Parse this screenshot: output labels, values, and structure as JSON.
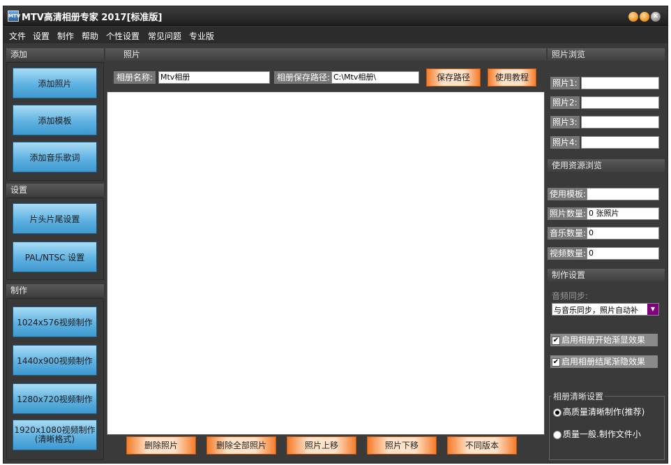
{
  "window": {
    "title": "MTV高清相册专家 2017[标准版]",
    "icon_text": "MTV"
  },
  "menu": [
    "文件",
    "设置",
    "制作",
    "帮助",
    "个性设置",
    "常见问题",
    "专业版"
  ],
  "left": {
    "add_header": "添加",
    "add_buttons": [
      "添加照片",
      "添加模板",
      "添加音乐歌词"
    ],
    "settings_header": "设置",
    "settings_buttons": [
      "片头片尾设置",
      "PAL/NTSC 设置"
    ],
    "make_header": "制作",
    "make_buttons": [
      "1024x576视频制作",
      "1440x900视频制作",
      "1280x720视频制作"
    ],
    "make_last": {
      "line1": "1920x1080视频制作",
      "line2": "(清晰格式)"
    }
  },
  "center": {
    "header": "照片",
    "album_name_label": "相册名称:",
    "album_name_value": "Mtv相册",
    "save_path_label": "相册保存路径:",
    "save_path_value": "C:\\Mtv相册\\",
    "save_path_button": "保存路径",
    "tutorial_button": "使用教程",
    "bottom_buttons": [
      "删除照片",
      "删除全部照片",
      "照片上移",
      "照片下移",
      "不同版本"
    ]
  },
  "right": {
    "photo_browse_header": "照片浏览",
    "photo_fields": [
      {
        "label": "照片1:",
        "value": ""
      },
      {
        "label": "照片2:",
        "value": ""
      },
      {
        "label": "照片3:",
        "value": ""
      },
      {
        "label": "照片4:",
        "value": ""
      }
    ],
    "resource_header": "使用资源浏览",
    "resource_fields": [
      {
        "label": "使用模板:",
        "value": ""
      },
      {
        "label": "照片数量:",
        "value": "0 张照片"
      },
      {
        "label": "音乐数量:",
        "value": "0"
      },
      {
        "label": "视频数量:",
        "value": "0"
      }
    ],
    "make_settings_header": "制作设置",
    "audio_sync_label": "音频同步:",
    "audio_sync_value": "与音乐同步，照片自动补",
    "fade_in_label": "启用相册开始渐显效果",
    "fade_in_checked": true,
    "fade_out_label": "启用相册结尾渐隐效果",
    "fade_out_checked": true,
    "clarity_group_label": "相册清晰设置",
    "clarity_options": [
      {
        "label": "高质量清晰制作(推荐)",
        "selected": true
      },
      {
        "label": "质量一般.制作文件小",
        "selected": false
      }
    ]
  },
  "colors": {
    "accent_orange": "#f57c2a",
    "button_blue": "#5fb2e2",
    "dropdown_purple": "#800080"
  }
}
